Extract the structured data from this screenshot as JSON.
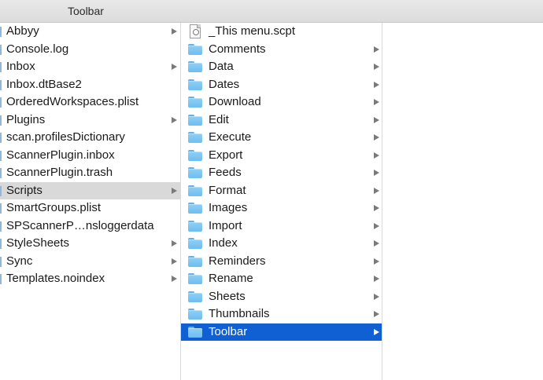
{
  "window": {
    "title": "Toolbar"
  },
  "column1": {
    "items": [
      {
        "label": "Abbyy",
        "arrow": true
      },
      {
        "label": "Console.log",
        "arrow": false
      },
      {
        "label": "Inbox",
        "arrow": true
      },
      {
        "label": "Inbox.dtBase2",
        "arrow": false
      },
      {
        "label": "OrderedWorkspaces.plist",
        "arrow": false
      },
      {
        "label": "Plugins",
        "arrow": true
      },
      {
        "label": "scan.profilesDictionary",
        "arrow": false
      },
      {
        "label": "ScannerPlugin.inbox",
        "arrow": false
      },
      {
        "label": "ScannerPlugin.trash",
        "arrow": false
      },
      {
        "label": "Scripts",
        "arrow": true,
        "selected": true
      },
      {
        "label": "SmartGroups.plist",
        "arrow": false
      },
      {
        "label": "SPScannerP…nsloggerdata",
        "arrow": false
      },
      {
        "label": "StyleSheets",
        "arrow": true
      },
      {
        "label": "Sync",
        "arrow": true
      },
      {
        "label": "Templates.noindex",
        "arrow": true
      }
    ]
  },
  "column2": {
    "items": [
      {
        "label": "_This menu.scpt",
        "icon": "script-file-icon",
        "arrow": false
      },
      {
        "label": "Comments",
        "icon": "folder-icon",
        "arrow": true
      },
      {
        "label": "Data",
        "icon": "folder-icon",
        "arrow": true
      },
      {
        "label": "Dates",
        "icon": "folder-icon",
        "arrow": true
      },
      {
        "label": "Download",
        "icon": "folder-icon",
        "arrow": true
      },
      {
        "label": "Edit",
        "icon": "folder-icon",
        "arrow": true
      },
      {
        "label": "Execute",
        "icon": "folder-icon",
        "arrow": true
      },
      {
        "label": "Export",
        "icon": "folder-icon",
        "arrow": true
      },
      {
        "label": "Feeds",
        "icon": "folder-icon",
        "arrow": true
      },
      {
        "label": "Format",
        "icon": "folder-icon",
        "arrow": true
      },
      {
        "label": "Images",
        "icon": "folder-icon",
        "arrow": true
      },
      {
        "label": "Import",
        "icon": "folder-icon",
        "arrow": true
      },
      {
        "label": "Index",
        "icon": "folder-icon",
        "arrow": true
      },
      {
        "label": "Reminders",
        "icon": "folder-icon",
        "arrow": true
      },
      {
        "label": "Rename",
        "icon": "folder-icon",
        "arrow": true
      },
      {
        "label": "Sheets",
        "icon": "folder-icon",
        "arrow": true
      },
      {
        "label": "Thumbnails",
        "icon": "folder-icon",
        "arrow": true
      },
      {
        "label": "Toolbar",
        "icon": "folder-icon",
        "arrow": true,
        "selected": true
      }
    ]
  },
  "colors": {
    "selection_active": "#1160d3",
    "selection_inactive": "#d9d9d9",
    "folder": "#7cc5f3"
  }
}
